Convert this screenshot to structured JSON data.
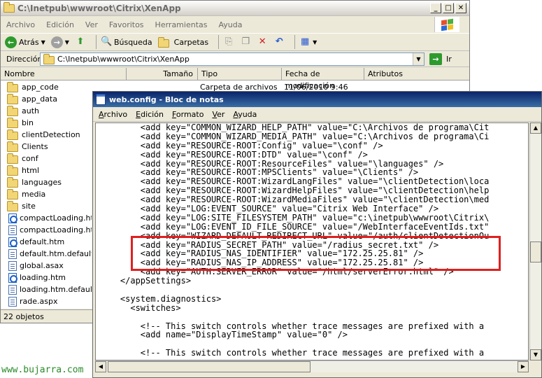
{
  "explorer": {
    "title": "C:\\Inetpub\\wwwroot\\Citrix\\XenApp",
    "menu": [
      "Archivo",
      "Edición",
      "Ver",
      "Favoritos",
      "Herramientas",
      "Ayuda"
    ],
    "toolbar": {
      "back_label": "Atrás",
      "search_label": "Búsqueda",
      "folders_label": "Carpetas"
    },
    "address": {
      "label": "Dirección",
      "value": "C:\\Inetpub\\wwwroot\\Citrix\\XenApp",
      "go_label": "Ir"
    },
    "columns": [
      "Nombre",
      "Tamaño",
      "Tipo",
      "Fecha de modificación",
      "Atributos"
    ],
    "first_row": {
      "type": "Carpeta de archivos",
      "date": "11/06/2010 9:46"
    },
    "files": [
      {
        "name": "app_code",
        "icon": "folder-icon"
      },
      {
        "name": "app_data",
        "icon": "folder-icon"
      },
      {
        "name": "auth",
        "icon": "folder-icon"
      },
      {
        "name": "bin",
        "icon": "folder-icon"
      },
      {
        "name": "clientDetection",
        "icon": "folder-icon"
      },
      {
        "name": "Clients",
        "icon": "folder-icon"
      },
      {
        "name": "conf",
        "icon": "folder-icon"
      },
      {
        "name": "html",
        "icon": "folder-icon"
      },
      {
        "name": "languages",
        "icon": "folder-icon"
      },
      {
        "name": "media",
        "icon": "folder-icon"
      },
      {
        "name": "site",
        "icon": "folder-icon"
      },
      {
        "name": "compactLoading.htm",
        "icon": "ie-file-icon"
      },
      {
        "name": "compactLoading.htm.d",
        "icon": "file-icon"
      },
      {
        "name": "default.htm",
        "icon": "ie-file-icon"
      },
      {
        "name": "default.htm.default",
        "icon": "file-icon"
      },
      {
        "name": "global.asax",
        "icon": "file-icon"
      },
      {
        "name": "loading.htm",
        "icon": "ie-file-icon"
      },
      {
        "name": "loading.htm.default",
        "icon": "file-icon"
      },
      {
        "name": "rade.aspx",
        "icon": "file-icon"
      }
    ],
    "status": "22 objetos"
  },
  "notepad": {
    "title": "web.config - Bloc de notas",
    "menu": [
      "Archivo",
      "Edición",
      "Formato",
      "Ver",
      "Ayuda"
    ],
    "lines": [
      "        <add key=\"COMMON_WIZARD_HELP_PATH\" value=\"C:\\Archivos de programa\\Cit",
      "        <add key=\"COMMON_WIZARD_MEDIA_PATH\" value=\"C:\\Archivos de programa\\Ci",
      "        <add key=\"RESOURCE-ROOT:Config\" value=\"\\conf\" />",
      "        <add key=\"RESOURCE-ROOT:DTD\" value=\"\\conf\" />",
      "        <add key=\"RESOURCE-ROOT:ResourceFiles\" value=\"\\languages\" />",
      "        <add key=\"RESOURCE-ROOT:MPSClients\" value=\"\\Clients\" />",
      "        <add key=\"RESOURCE-ROOT:WizardLangFiles\" value=\"\\clientDetection\\loca",
      "        <add key=\"RESOURCE-ROOT:WizardHelpFiles\" value=\"\\clientDetection\\help",
      "        <add key=\"RESOURCE-ROOT:WizardMediaFiles\" value=\"\\clientDetection\\med",
      "        <add key=\"LOG:EVENT_SOURCE\" value=\"Citrix Web Interface\" />",
      "        <add key=\"LOG:SITE_FILESYSTEM_PATH\" value=\"c:\\inetpub\\wwwroot\\Citrix\\",
      "        <add key=\"LOG:EVENT_ID_FILE_SOURCE\" value=\"/WebInterfaceEventIds.txt\"",
      "        <add key=\"WIZARD_DEFAULT_REDIRECT_URL\" value=\"/auth/clientDetectionOu",
      "        <add key=\"RADIUS_SECRET_PATH\" value=\"/radius_secret.txt\" />",
      "        <add key=\"RADIUS_NAS_IDENTIFIER\" value=\"172.25.25.81\" />",
      "        <add key=\"RADIUS_NAS_IP_ADDRESS\" value=\"172.25.25.81\" />",
      "        <add key=\"AUTH:SERVER_ERROR\" value=\"/html/serverError.html\" />",
      "    </appSettings>",
      "",
      "    <system.diagnostics>",
      "      <switches>",
      "",
      "        <!-- This switch controls whether trace messages are prefixed with a",
      "        <add name=\"DisplayTimeStamp\" value=\"0\" />",
      "",
      "        <!-- This switch controls whether trace messages are prefixed with a"
    ]
  },
  "watermark": "www.bujarra.com"
}
